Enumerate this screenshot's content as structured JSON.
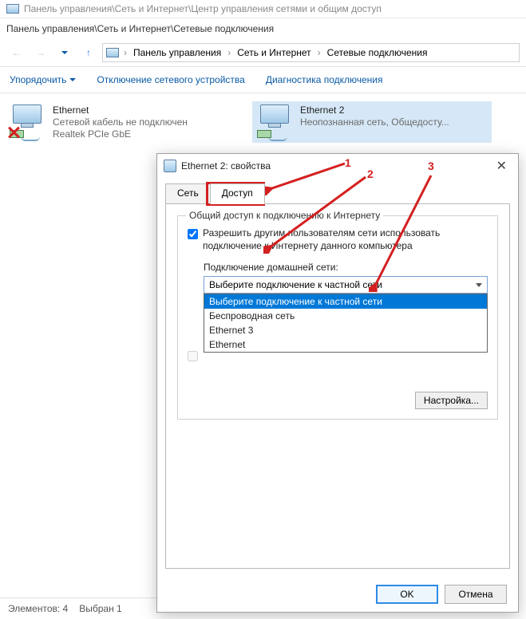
{
  "bg_window": {
    "title": "Панель управления\\Сеть и Интернет\\Центр управления сетями и общим доступ"
  },
  "window": {
    "title": "Панель управления\\Сеть и Интернет\\Сетевые подключения"
  },
  "breadcrumb": {
    "c1": "Панель управления",
    "c2": "Сеть и Интернет",
    "c3": "Сетевые подключения"
  },
  "toolbar": {
    "organize": "Упорядочить",
    "disable": "Отключение сетевого устройства",
    "diagnose": "Диагностика подключения"
  },
  "connections": {
    "eth1": {
      "name": "Ethernet",
      "status": "Сетевой кабель не подключен",
      "adapter": "Realtek PCIe GbE"
    },
    "eth2": {
      "name": "Ethernet 2",
      "status": "Неопознанная сеть, Общедосту..."
    }
  },
  "statusbar": {
    "count": "Элементов: 4",
    "selected": "Выбран 1"
  },
  "dialog": {
    "title": "Ethernet 2: свойства",
    "tabs": {
      "network": "Сеть",
      "sharing": "Доступ"
    },
    "group_title": "Общий доступ к подключению к Интернету",
    "check1": "Разрешить другим пользователям сети использовать подключение к Интернету данного компьютера",
    "sub_label": "Подключение домашней сети:",
    "combo_text": "Выберите подключение к частной сети",
    "options": {
      "o1": "Выберите подключение к частной сети",
      "o2": "Беспроводная сеть",
      "o3": "Ethernet 3",
      "o4": "Ethernet"
    },
    "settings_btn": "Настройка...",
    "ok": "OK",
    "cancel": "Отмена"
  },
  "annotations": {
    "n1": "1",
    "n2": "2",
    "n3": "3"
  }
}
